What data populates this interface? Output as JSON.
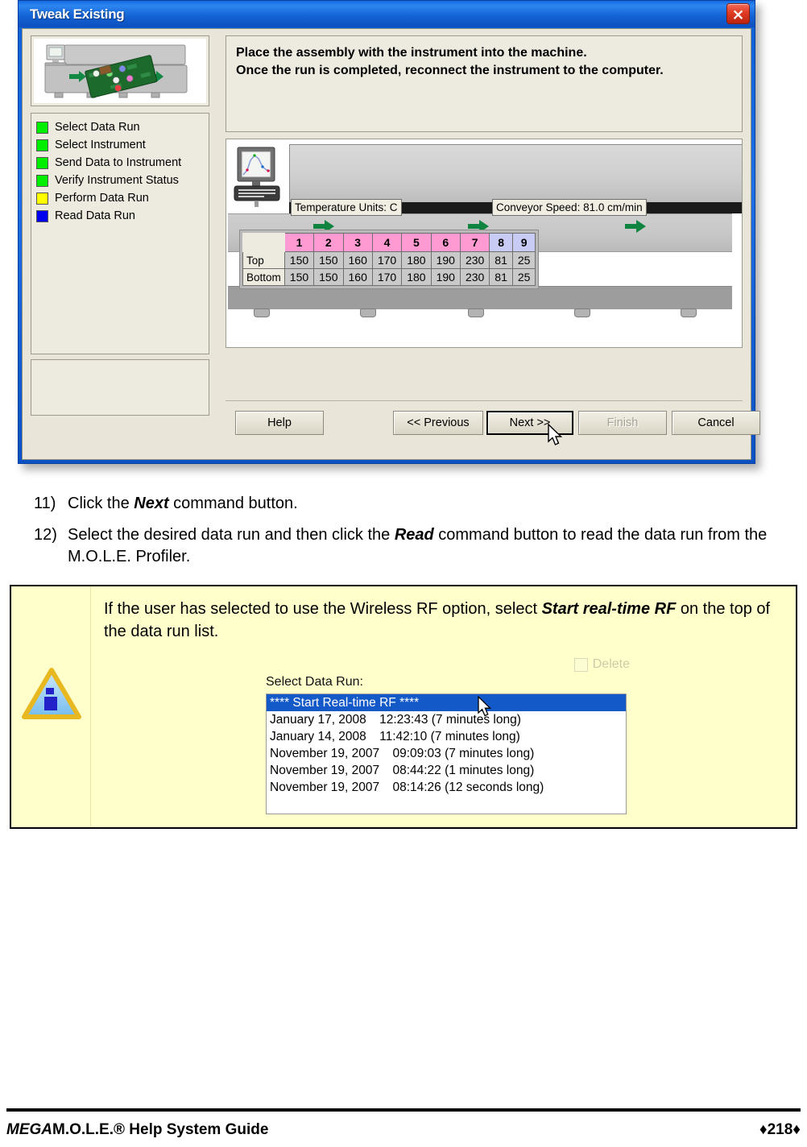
{
  "dialog": {
    "title": "Tweak Existing",
    "close_icon": "close-icon",
    "instructions": [
      "Place the assembly with the instrument into the machine.",
      "Once the run is completed, reconnect the instrument to the computer."
    ],
    "steps": [
      {
        "label": "Select Data Run",
        "color": "#00EE00"
      },
      {
        "label": "Select Instrument",
        "color": "#00EE00"
      },
      {
        "label": "Send Data to Instrument",
        "color": "#00EE00"
      },
      {
        "label": "Verify Instrument Status",
        "color": "#00EE00"
      },
      {
        "label": "Perform Data Run",
        "color": "#FFFF00"
      },
      {
        "label": "Read Data Run",
        "color": "#0000EE"
      }
    ],
    "machine": {
      "temperature_units_label": "Temperature Units: C",
      "conveyor_speed_label": "Conveyor Speed: 81.0 cm/min"
    },
    "zone_table": {
      "zones": [
        "1",
        "2",
        "3",
        "4",
        "5",
        "6",
        "7",
        "8",
        "9"
      ],
      "zone_colors": [
        "pink",
        "pink",
        "pink",
        "pink",
        "pink",
        "pink",
        "pink",
        "blue",
        "blue"
      ],
      "rows": [
        {
          "name": "Top",
          "values": [
            "150",
            "150",
            "160",
            "170",
            "180",
            "190",
            "230",
            "81",
            "25"
          ]
        },
        {
          "name": "Bottom",
          "values": [
            "150",
            "150",
            "160",
            "170",
            "180",
            "190",
            "230",
            "81",
            "25"
          ]
        }
      ]
    },
    "buttons": [
      {
        "label": "Help",
        "state": "normal"
      },
      {
        "label": "<< Previous",
        "state": "normal"
      },
      {
        "label": "Next >>",
        "state": "focused"
      },
      {
        "label": "Finish",
        "state": "disabled"
      },
      {
        "label": "Cancel",
        "state": "normal"
      }
    ]
  },
  "body": {
    "items": [
      {
        "num": "11)",
        "parts": [
          {
            "text": "Click the ",
            "style": "normal"
          },
          {
            "text": "Next",
            "style": "bold-italic"
          },
          {
            "text": " command button.",
            "style": "normal"
          }
        ]
      },
      {
        "num": "12)",
        "parts": [
          {
            "text": "Select the desired data run and then click the ",
            "style": "normal"
          },
          {
            "text": "Read",
            "style": "bold-italic"
          },
          {
            "text": " command button to read the data run from the M.O.L.E. Profiler.",
            "style": "normal"
          }
        ]
      }
    ]
  },
  "note": {
    "icon": "info-triangle-icon",
    "parts": [
      {
        "text": "If the user has selected to use the Wireless RF option, select ",
        "style": "normal"
      },
      {
        "text": "Start real-time RF",
        "style": "bold-italic"
      },
      {
        "text": " on the top of the data run list.",
        "style": "normal"
      }
    ],
    "screenshot": {
      "delete_label": "Delete",
      "list_title": "Select Data Run:",
      "rows": [
        {
          "date": "**** Start Real-time RF ****",
          "time": "",
          "selected": true
        },
        {
          "date": "January 17, 2008",
          "time": "12:23:43 (7 minutes long)",
          "selected": false
        },
        {
          "date": "January 14, 2008",
          "time": "11:42:10 (7 minutes long)",
          "selected": false
        },
        {
          "date": "November 19, 2007",
          "time": "09:09:03 (7 minutes long)",
          "selected": false
        },
        {
          "date": "November 19, 2007",
          "time": "08:44:22 (1 minutes long)",
          "selected": false
        },
        {
          "date": "November 19, 2007",
          "time": "08:14:26 (12 seconds long)",
          "selected": false
        }
      ]
    }
  },
  "footer": {
    "left_italic": "MEGA",
    "left_rest": "M.O.L.E.® Help System Guide",
    "page": "♦218♦"
  }
}
